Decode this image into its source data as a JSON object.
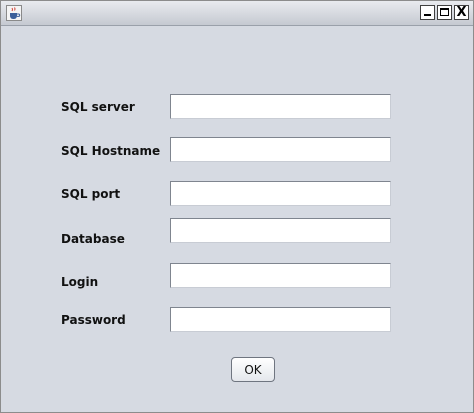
{
  "window": {
    "icon": "java-cup-icon",
    "controls": [
      "minimize-icon",
      "maximize-icon",
      "close-icon"
    ],
    "close_glyph": "X"
  },
  "form": {
    "fields": [
      {
        "label": "SQL server",
        "value": ""
      },
      {
        "label": "SQL Hostname",
        "value": ""
      },
      {
        "label": "SQL port",
        "value": ""
      },
      {
        "label": "Database",
        "value": ""
      },
      {
        "label": "Login",
        "value": ""
      },
      {
        "label": "Password",
        "value": ""
      }
    ],
    "ok_label": "OK"
  }
}
